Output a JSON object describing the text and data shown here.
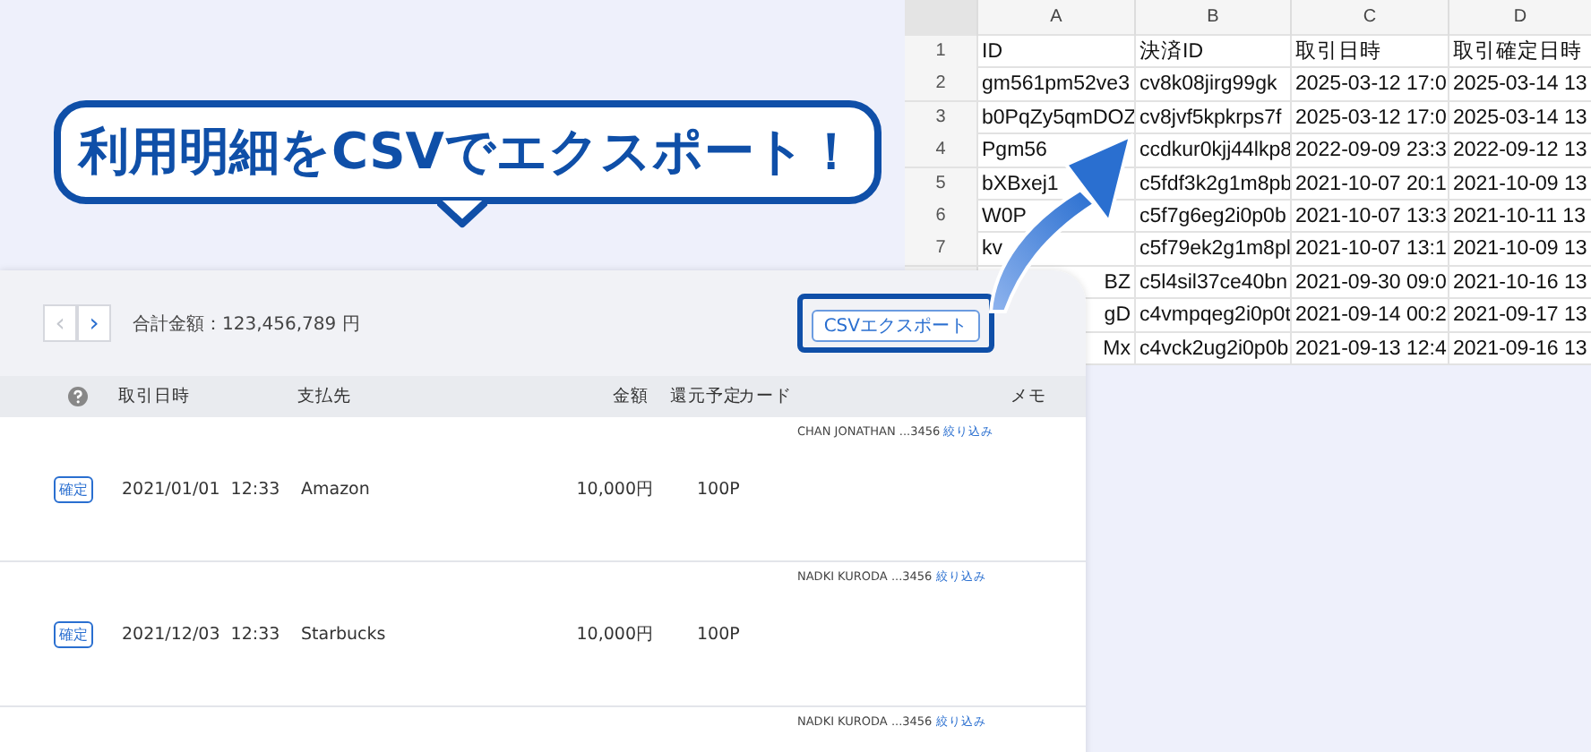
{
  "callout": {
    "text": "利用明細をCSVでエクスポート！"
  },
  "spreadsheet": {
    "columns": [
      "A",
      "B",
      "C",
      "D"
    ],
    "rows": [
      {
        "num": "1",
        "cells": [
          "ID",
          "決済ID",
          "取引日時",
          "取引確定日時"
        ]
      },
      {
        "num": "2",
        "cells": [
          "gm561pm52ve3",
          "cv8k08jirg99gk",
          "2025-03-12 17:0",
          "2025-03-14 13"
        ]
      },
      {
        "num": "3",
        "cells": [
          "b0PqZy5qmDOZ",
          "cv8jvf5kpkrps7f",
          "2025-03-12 17:0",
          "2025-03-14 13"
        ]
      },
      {
        "num": "4",
        "cells": [
          "Pgm56",
          "ccdkur0kjj44lkp8",
          "2022-09-09 23:3",
          "2022-09-12 13"
        ]
      },
      {
        "num": "5",
        "cells": [
          "bXBxej1",
          "c5fdf3k2g1m8pb",
          "2021-10-07 20:1",
          "2021-10-09 13"
        ]
      },
      {
        "num": "6",
        "cells": [
          "W0P",
          "c5f7g6eg2i0p0b",
          "2021-10-07 13:3",
          "2021-10-11 13"
        ]
      },
      {
        "num": "7",
        "cells": [
          "kv",
          "c5f79ek2g1m8pl",
          "2021-10-07 13:1",
          "2021-10-09 13"
        ]
      },
      {
        "covered": true,
        "cells": [
          "BZ",
          "c5l4sil37ce40bn",
          "2021-09-30 09:0",
          "2021-10-16 13"
        ]
      },
      {
        "covered": true,
        "cells": [
          "gD",
          "c4vmpqeg2i0p0t",
          "2021-09-14 00:2",
          "2021-09-17 13"
        ]
      },
      {
        "covered": true,
        "cells": [
          "Mx",
          "c4vck2ug2i0p0b",
          "2021-09-13 12:4",
          "2021-09-16 13"
        ]
      }
    ]
  },
  "statement": {
    "nav": [
      {
        "symbol": "‹",
        "disabled": true
      },
      {
        "symbol": "›",
        "disabled": false
      }
    ],
    "total": "合計金額：123,456,789 円",
    "export_button": "CSVエクスポート",
    "export_highlighted": true,
    "columns": [
      "取引日時",
      "支払先",
      "金額",
      "還元予定",
      "カード",
      "メモ"
    ],
    "rows": [
      {
        "status": "確定",
        "date": "2021/01/01  12:33",
        "payee": "Amazon",
        "amount": "10,000円",
        "points": "100P",
        "card": "CHAN JONATHAN ...3456",
        "card_link": "絞り込み"
      },
      {
        "status": "確定",
        "date": "2021/12/03  12:33",
        "payee": "Starbucks",
        "amount": "10,000円",
        "points": "100P",
        "card": "NADKI KURODA ...3456",
        "card_link": "絞り込み"
      },
      {
        "card": "NADKI KURODA ...3456",
        "card_link": "絞り込み"
      }
    ]
  }
}
